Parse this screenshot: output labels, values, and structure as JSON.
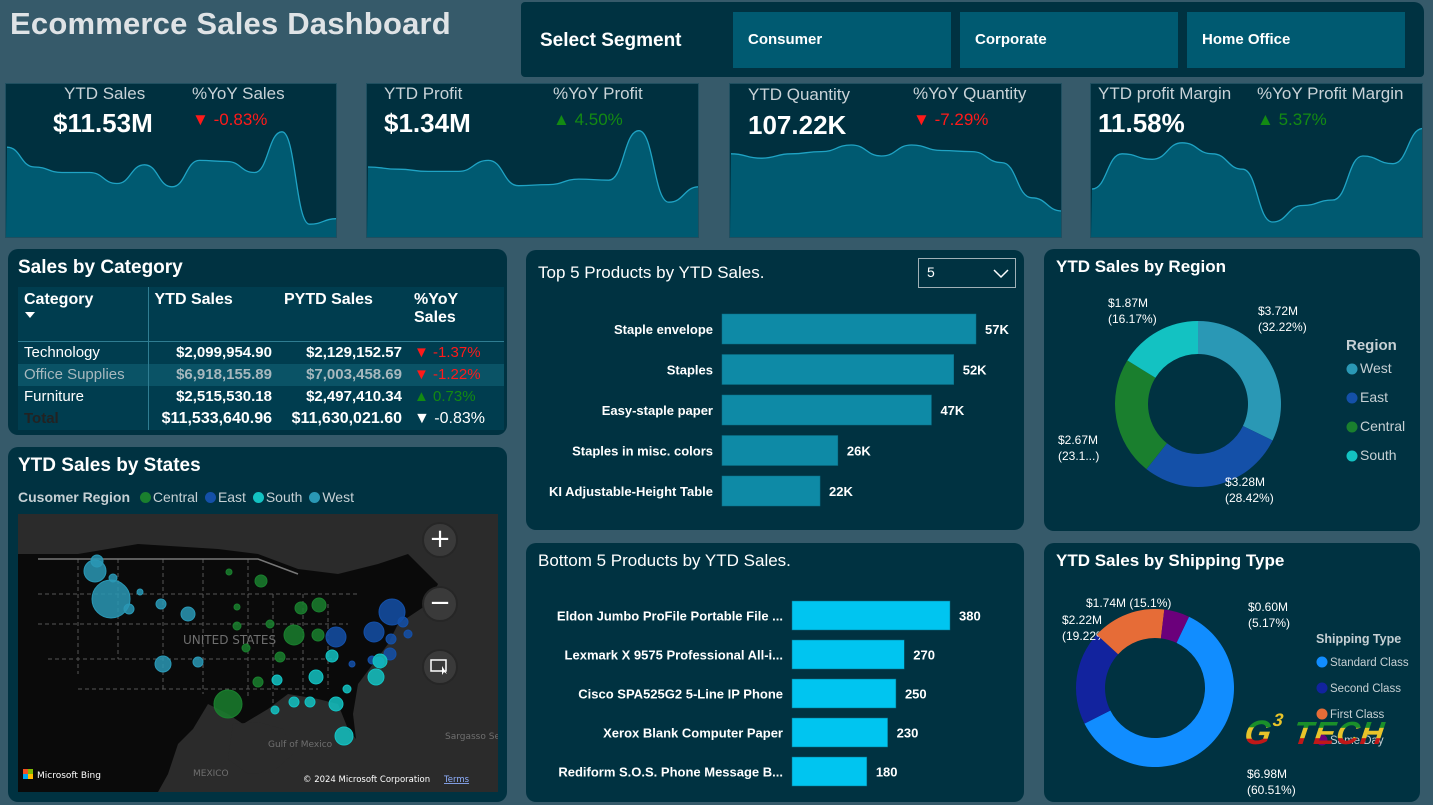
{
  "header": {
    "title": "Ecommerce Sales Dashboard"
  },
  "segment_slicer": {
    "label": "Select Segment",
    "options": [
      "Consumer",
      "Corporate",
      "Home Office"
    ]
  },
  "kpis": [
    {
      "label": "YTD Sales",
      "value": "$11.53M",
      "change_label": "%YoY Sales",
      "change": "-0.83%",
      "direction": "down",
      "trend": [
        0.78,
        0.6,
        0.55,
        0.55,
        0.45,
        0.62,
        0.42,
        0.66,
        0.65,
        0.55,
        0.92,
        0.08,
        0.13
      ]
    },
    {
      "label": "YTD Profit",
      "value": "$1.34M",
      "change_label": "%YoY Profit",
      "change": "4.50%",
      "direction": "up",
      "trend": [
        0.6,
        0.58,
        0.56,
        0.56,
        0.66,
        0.43,
        0.44,
        0.49,
        0.48,
        0.93,
        0.28,
        0.42
      ]
    },
    {
      "label": "YTD Quantity",
      "value": "107.22K",
      "change_label": "%YoY Quantity",
      "change": "-7.29%",
      "direction": "down",
      "trend": [
        0.72,
        0.68,
        0.72,
        0.74,
        0.8,
        0.7,
        0.8,
        0.75,
        0.74,
        0.64,
        0.32,
        0.2
      ]
    },
    {
      "label": "YTD profit Margin",
      "value": "11.58%",
      "change_label": "%YoY Profit Margin",
      "change": "5.37%",
      "direction": "up",
      "trend": [
        0.4,
        0.72,
        0.67,
        0.82,
        0.72,
        0.58,
        0.1,
        0.25,
        0.3,
        0.7,
        0.63,
        0.95
      ]
    }
  ],
  "sales_by_category": {
    "title": "Sales by Category",
    "columns": [
      "Category",
      "YTD Sales",
      "PYTD Sales",
      "%YoY Sales"
    ],
    "rows": [
      {
        "category": "Technology",
        "ytd": "$2,099,954.90",
        "pytd": "$2,129,152.57",
        "yoy": "-1.37%",
        "direction": "down"
      },
      {
        "category": "Office Supplies",
        "ytd": "$6,918,155.89",
        "pytd": "$7,003,458.69",
        "yoy": "-1.22%",
        "direction": "down"
      },
      {
        "category": "Furniture",
        "ytd": "$2,515,530.18",
        "pytd": "$2,497,410.34",
        "yoy": "0.73%",
        "direction": "up"
      }
    ],
    "total": {
      "category": "Total",
      "ytd": "$11,533,640.96",
      "pytd": "$11,630,021.60",
      "yoy": "-0.83%",
      "direction": "down"
    }
  },
  "sales_by_states": {
    "title": "YTD Sales by States",
    "legend_title": "Cusomer Region",
    "legend": [
      {
        "name": "Central",
        "color": "#1a7f2e"
      },
      {
        "name": "East",
        "color": "#1450a8"
      },
      {
        "name": "South",
        "color": "#13c2c2"
      },
      {
        "name": "West",
        "color": "#2a98b5"
      }
    ],
    "map_labels": {
      "country": "UNITED STATES",
      "gulf": "Gulf of Mexico",
      "mexico": "MEXICO",
      "sea": "Sargasso Se",
      "brand": "Microsoft Bing",
      "copyright": "© 2024 Microsoft Corporation",
      "terms": "Terms"
    },
    "controls": {
      "zoom_in": "+",
      "zoom_out": "−"
    }
  },
  "top_products": {
    "title": "Top 5 Products by YTD Sales.",
    "topn_value": "5"
  },
  "bottom_products": {
    "title": "Bottom 5 Products by YTD Sales."
  },
  "region_donut": {
    "title": "YTD Sales by Region",
    "legend_title": "Region"
  },
  "shipping_donut": {
    "title": "YTD Sales by Shipping Type",
    "legend_title": "Shipping Type"
  },
  "watermark": {
    "text_g": "G",
    "text_sup": "3",
    "text_tech": "TECH"
  },
  "chart_data": [
    {
      "type": "bar",
      "title": "Top 5 Products by YTD Sales.",
      "orientation": "horizontal",
      "categories": [
        "Staple envelope",
        "Staples",
        "Easy-staple paper",
        "Staples in misc. colors",
        "KI Adjustable-Height Table"
      ],
      "values": [
        57000,
        52000,
        47000,
        26000,
        22000
      ],
      "labels": [
        "57K",
        "52K",
        "47K",
        "26K",
        "22K"
      ],
      "color": "#0e8aa6"
    },
    {
      "type": "bar",
      "title": "Bottom 5 Products by YTD Sales.",
      "orientation": "horizontal",
      "categories": [
        "Eldon Jumbo ProFile Portable File ...",
        "Lexmark X 9575 Professional All-i...",
        "Cisco SPA525G2 5-Line IP Phone",
        "Xerox Blank Computer Paper",
        "Rediform S.O.S. Phone Message B..."
      ],
      "values": [
        380,
        270,
        250,
        230,
        180
      ],
      "labels": [
        "380",
        "270",
        "250",
        "230",
        "180"
      ],
      "color": "#00c5f0"
    },
    {
      "type": "pie",
      "title": "YTD Sales by Region",
      "legend_title": "Region",
      "legend_position": "right",
      "slices": [
        {
          "name": "West",
          "value": 3.72,
          "label": "$3.72M",
          "pct": "(32.22%)",
          "color": "#2a98b5"
        },
        {
          "name": "East",
          "value": 3.28,
          "label": "$3.28M",
          "pct": "(28.42%)",
          "color": "#1450a8"
        },
        {
          "name": "Central",
          "value": 2.67,
          "label": "$2.67M",
          "pct": "(23.1...)",
          "color": "#1a7f2e"
        },
        {
          "name": "South",
          "value": 1.87,
          "label": "$1.87M",
          "pct": "(16.17%)",
          "color": "#13c2c2"
        }
      ]
    },
    {
      "type": "pie",
      "title": "YTD Sales by Shipping Type",
      "legend_title": "Shipping Type",
      "legend_position": "right",
      "slices": [
        {
          "name": "Standard Class",
          "value": 6.98,
          "label": "$6.98M",
          "pct": "(60.51%)",
          "color": "#118dff"
        },
        {
          "name": "Second Class",
          "value": 2.22,
          "label": "$2.22M",
          "pct": "(19.22%)",
          "color": "#12239e"
        },
        {
          "name": "First Class",
          "value": 1.74,
          "label": "$1.74M",
          "pct": "(15.1%)",
          "color": "#e66c37"
        },
        {
          "name": "Same Day",
          "value": 0.6,
          "label": "$0.60M",
          "pct": "(5.17%)",
          "color": "#6b007b"
        }
      ]
    }
  ]
}
